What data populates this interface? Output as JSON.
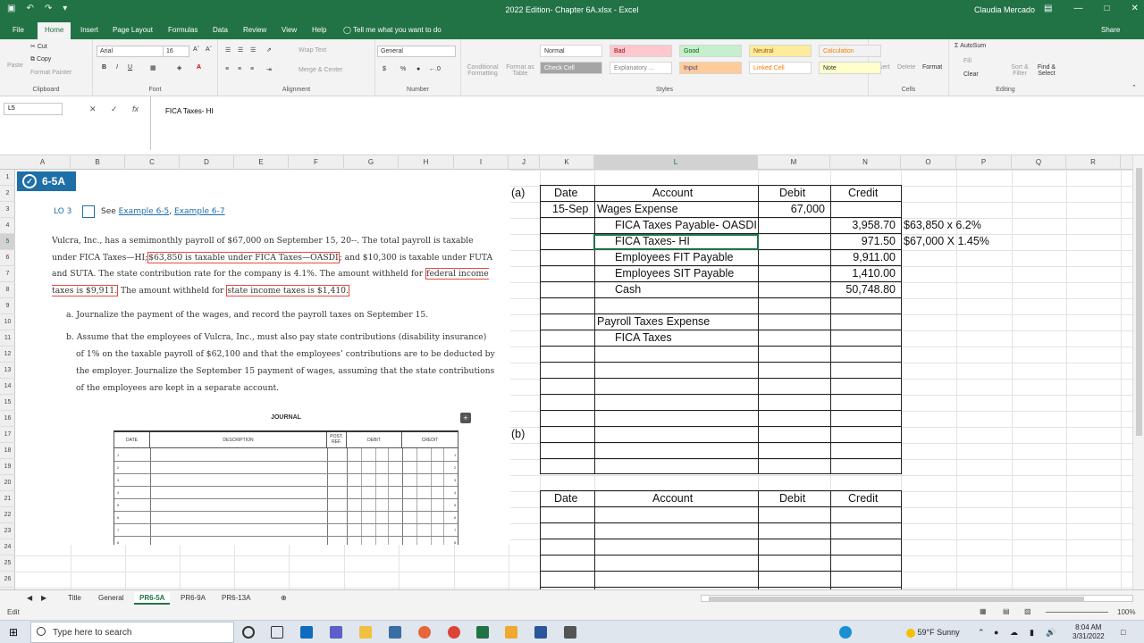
{
  "window": {
    "title": "2022 Edition- Chapter 6A.xlsx  -  Excel",
    "user": "Claudia Mercado"
  },
  "tabs": [
    "File",
    "Home",
    "Insert",
    "Page Layout",
    "Formulas",
    "Data",
    "Review",
    "View",
    "Help"
  ],
  "tell_me": "Tell me what you want to do",
  "share": "Share",
  "ribbon": {
    "clipboard": {
      "label": "Clipboard",
      "cut": "Cut",
      "copy": "Copy",
      "format_painter": "Format Painter",
      "paste": "Paste"
    },
    "font": {
      "label": "Font",
      "name": "Arial",
      "size": "16"
    },
    "alignment": {
      "label": "Alignment",
      "wrap": "Wrap Text",
      "merge": "Merge & Center"
    },
    "number": {
      "label": "Number",
      "format": "General"
    },
    "styles": {
      "label": "Styles",
      "conditional": "Conditional Formatting",
      "format_table": "Format as Table",
      "cells": [
        {
          "name": "Normal",
          "bg": "#ffffff",
          "fg": "#333333"
        },
        {
          "name": "Bad",
          "bg": "#ffc7ce",
          "fg": "#9c0006"
        },
        {
          "name": "Good",
          "bg": "#c6efce",
          "fg": "#006100"
        },
        {
          "name": "Neutral",
          "bg": "#ffeb9c",
          "fg": "#9c5700"
        },
        {
          "name": "Calculation",
          "bg": "#f2f2f2",
          "fg": "#fa7d00"
        },
        {
          "name": "Check Cell",
          "bg": "#a5a5a5",
          "fg": "#ffffff"
        },
        {
          "name": "Explanatory ...",
          "bg": "#ffffff",
          "fg": "#7f7f7f"
        },
        {
          "name": "Input",
          "bg": "#ffcc99",
          "fg": "#3f3f76"
        },
        {
          "name": "Linked Cell",
          "bg": "#ffffff",
          "fg": "#fa7d00"
        },
        {
          "name": "Note",
          "bg": "#ffffcc",
          "fg": "#333333"
        }
      ]
    },
    "cells": {
      "label": "Cells",
      "insert": "Insert",
      "delete": "Delete",
      "format": "Format"
    },
    "editing": {
      "label": "Editing",
      "autosum": "AutoSum",
      "fill": "Fill",
      "clear": "Clear",
      "sort": "Sort & Filter",
      "find": "Find & Select"
    }
  },
  "formula_bar": {
    "name_box": "L5",
    "formula": "FICA Taxes- HI"
  },
  "columns": [
    "A",
    "B",
    "C",
    "D",
    "E",
    "F",
    "G",
    "H",
    "I",
    "J",
    "K",
    "L",
    "M",
    "N",
    "O",
    "P",
    "Q",
    "R"
  ],
  "rows": [
    "1",
    "2",
    "3",
    "4",
    "5",
    "6",
    "7",
    "8",
    "9",
    "10",
    "11",
    "12",
    "13",
    "14",
    "15",
    "16",
    "17",
    "18",
    "19",
    "20",
    "21",
    "22",
    "23",
    "24",
    "25",
    "26"
  ],
  "problem": {
    "badge": "6-5A",
    "lo": "LO 3",
    "see": "See",
    "ex1": "Example 6-5",
    "ex2": "Example 6-7",
    "p1": "Vulcra, Inc., has a semimonthly payroll of $67,000 on September 15, 20--. The total payroll is taxable under FICA Taxes—HI;",
    "p_hl1": "$63,850 is taxable under FICA Taxes—OASDI",
    "p2": "; and $10,300 is taxable under FUTA and SUTA. The state contribution rate for the company is 4.1%. The amount withheld for",
    "p_hl2": "federal income taxes is $9,911.",
    "p3": " The amount withheld for",
    "p_hl3": "state income taxes is $1,410.",
    "qa": "a.  Journalize the payment of the wages, and record the payroll taxes on September 15.",
    "qb": "b.  Assume that the employees of Vulcra, Inc., must also pay state contributions (disability insurance) of 1% on the taxable payroll of $62,100 and that the employees’ contributions are to be deducted by the employer. Journalize the September 15 payment of wages, assuming that the state contributions of the employees are kept in a separate account.",
    "journal": {
      "title": "JOURNAL",
      "date": "DATE",
      "description": "DESCRIPTION",
      "post_ref": "POST. REF.",
      "debit": "DEBIT",
      "credit": "CREDIT",
      "line_numbers": [
        "1",
        "2",
        "3",
        "4",
        "5",
        "6",
        "7",
        "8"
      ]
    }
  },
  "worksheet": {
    "label_a": "(a)",
    "label_b": "(b)",
    "headers": {
      "date": "Date",
      "account": "Account",
      "debit": "Debit",
      "credit": "Credit"
    },
    "entries": [
      {
        "date": "15-Sep",
        "account": "Wages Expense",
        "indent": false,
        "debit": "67,000",
        "credit": "",
        "note": ""
      },
      {
        "date": "",
        "account": "FICA Taxes Payable- OASDI",
        "indent": true,
        "debit": "",
        "credit": "3,958.70",
        "note": "$63,850 x 6.2%"
      },
      {
        "date": "",
        "account": "FICA Taxes- HI",
        "indent": true,
        "debit": "",
        "credit": "971.50",
        "note": "$67,000 X 1.45%"
      },
      {
        "date": "",
        "account": "Employees FIT Payable",
        "indent": true,
        "debit": "",
        "credit": "9,911.00",
        "note": ""
      },
      {
        "date": "",
        "account": "Employees SIT Payable",
        "indent": true,
        "debit": "",
        "credit": "1,410.00",
        "note": ""
      },
      {
        "date": "",
        "account": "Cash",
        "indent": true,
        "debit": "",
        "credit": "50,748.80",
        "note": ""
      },
      {
        "date": "",
        "account": "",
        "indent": false,
        "debit": "",
        "credit": "",
        "note": ""
      },
      {
        "date": "",
        "account": "Payroll Taxes Expense",
        "indent": false,
        "debit": "",
        "credit": "",
        "note": ""
      },
      {
        "date": "",
        "account": "FICA Taxes",
        "indent": true,
        "debit": "",
        "credit": "",
        "note": ""
      }
    ]
  },
  "sheets": [
    "Title",
    "General",
    "PR6-5A",
    "PR6-9A",
    "PR6-13A"
  ],
  "active_sheet": "PR6-5A",
  "status": {
    "mode": "Edit",
    "zoom": "100%"
  },
  "taskbar": {
    "search": "Type here to search",
    "weather": "59°F  Sunny",
    "time": "8:04 AM",
    "date": "3/31/2022"
  }
}
